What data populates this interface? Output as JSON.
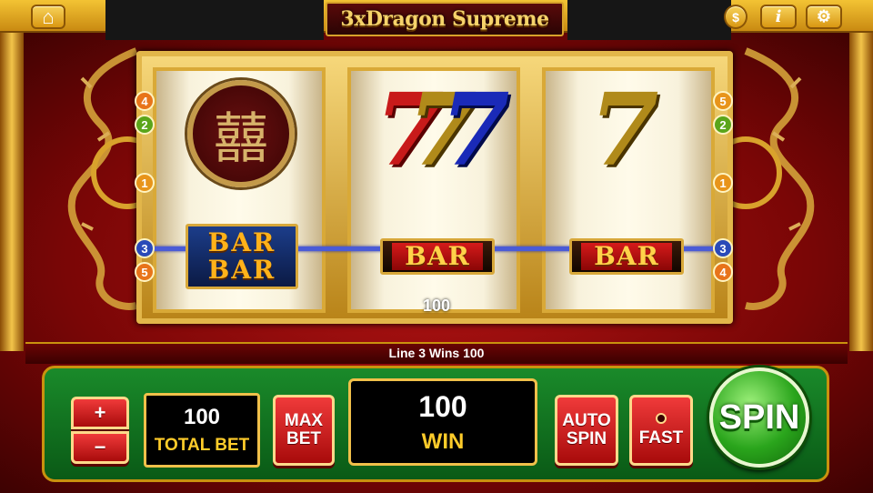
{
  "top_bar": {
    "title": "3xDragon Supreme",
    "buttons": [
      {
        "name": "home",
        "icon": "home-icon",
        "glyph": "⌂"
      },
      {
        "name": "coins",
        "icon": "coin-icon",
        "glyph": "$"
      },
      {
        "name": "info",
        "icon": "info-icon",
        "glyph": "i"
      },
      {
        "name": "settings",
        "icon": "gear-icon",
        "glyph": "⚙"
      }
    ]
  },
  "reels": [
    {
      "symbols": [
        "double-happiness-coin",
        "BAR BAR"
      ]
    },
    {
      "symbols": [
        "777",
        "BAR"
      ]
    },
    {
      "symbols": [
        "7",
        "BAR"
      ]
    }
  ],
  "symbols": {
    "double_bar_top": "BAR",
    "double_bar_bottom": "BAR",
    "single_bar": "BAR",
    "triple_seven": "777",
    "single_seven": "7",
    "coin_glyph": "囍"
  },
  "line_markers": {
    "left": [
      "4",
      "2",
      "1",
      "3",
      "5"
    ],
    "right": [
      "5",
      "2",
      "1",
      "3",
      "4"
    ]
  },
  "reel_win_amount": "100",
  "message": "Line 3 Wins 100",
  "controls": {
    "plus": "+",
    "minus": "−",
    "total_bet_value": "100",
    "total_bet_label": "TOTAL BET",
    "max_bet_line1": "MAX",
    "max_bet_line2": "BET",
    "win_value": "100",
    "win_label": "WIN",
    "auto_spin_line1": "AUTO",
    "auto_spin_line2": "SPIN",
    "fast": "FAST",
    "spin": "SPIN"
  },
  "colors": {
    "gold": "#e2b64a",
    "red_button": "#d81f1f",
    "spin_green": "#2aa51c",
    "payline_blue": "#4a5bd6"
  }
}
